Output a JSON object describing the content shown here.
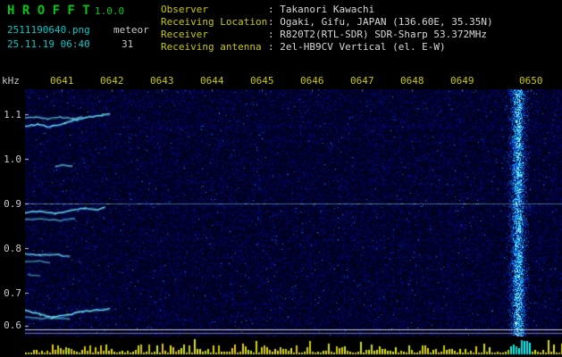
{
  "header": {
    "app_title": "H R O F F T",
    "version": "1.0.0",
    "filename": "2511190640.png",
    "station": "meteor",
    "datetime": "25.11.19 06:40",
    "echo_count": "31",
    "separator": ":",
    "info": [
      {
        "label": "Observer",
        "value": "Takanori Kawachi"
      },
      {
        "label": "Receiving Location",
        "value": "Ogaki, Gifu, JAPAN (136.60E, 35.35N)"
      },
      {
        "label": "Receiver",
        "value": "R820T2(RTL-SDR) SDR-Sharp 53.372MHz"
      },
      {
        "label": "Receiving antenna",
        "value": "2el-HB9CV Vertical (el. E-W)"
      }
    ]
  },
  "chart_data": {
    "type": "heatmap",
    "title": "HROFFT radio meteor spectrogram 0640-0650",
    "x_axis": {
      "tick_labels": [
        "0641",
        "0642",
        "0643",
        "0644",
        "0645",
        "0646",
        "0647",
        "0648",
        "0649",
        "0650"
      ],
      "minutes_per_division": 1
    },
    "y_axis": {
      "label": "kHz",
      "tick_labels": [
        "1.1",
        "1.0",
        "0.9",
        "0.8",
        "0.7",
        "0.6"
      ],
      "range_khz": [
        0.6,
        1.16
      ]
    },
    "carrier_line_khz": 0.9,
    "baseline_lines_khz": [
      0.618,
      0.61
    ],
    "echo_traces": [
      {
        "name": "drift-1a",
        "intensity": 0.95,
        "points": [
          [
            0,
            1.073
          ],
          [
            0.25,
            1.077
          ],
          [
            0.5,
            1.071
          ],
          [
            0.8,
            1.08
          ],
          [
            1.05,
            1.088
          ],
          [
            1.3,
            1.094
          ],
          [
            1.55,
            1.098
          ],
          [
            1.7,
            1.1
          ]
        ]
      },
      {
        "name": "drift-1b",
        "intensity": 0.65,
        "points": [
          [
            0,
            1.091
          ],
          [
            0.2,
            1.094
          ],
          [
            0.45,
            1.089
          ],
          [
            0.7,
            1.093
          ],
          [
            0.95,
            1.09
          ],
          [
            1.15,
            1.093
          ]
        ]
      },
      {
        "name": "dash-0.98",
        "intensity": 0.7,
        "points": [
          [
            0.6,
            0.984
          ],
          [
            0.75,
            0.986
          ],
          [
            0.95,
            0.983
          ]
        ]
      },
      {
        "name": "drift-2a",
        "intensity": 0.9,
        "points": [
          [
            0,
            0.879
          ],
          [
            0.3,
            0.883
          ],
          [
            0.6,
            0.877
          ],
          [
            0.9,
            0.884
          ],
          [
            1.2,
            0.889
          ],
          [
            1.45,
            0.886
          ],
          [
            1.6,
            0.891
          ]
        ]
      },
      {
        "name": "drift-2b",
        "intensity": 0.55,
        "points": [
          [
            0,
            0.864
          ],
          [
            0.35,
            0.866
          ],
          [
            0.7,
            0.862
          ],
          [
            1.0,
            0.866
          ]
        ]
      },
      {
        "name": "drift-3a",
        "intensity": 0.8,
        "points": [
          [
            0,
            0.787
          ],
          [
            0.3,
            0.784
          ],
          [
            0.6,
            0.786
          ],
          [
            0.9,
            0.781
          ]
        ]
      },
      {
        "name": "drift-3b",
        "intensity": 0.5,
        "points": [
          [
            0,
            0.769
          ],
          [
            0.25,
            0.771
          ],
          [
            0.5,
            0.768
          ]
        ]
      },
      {
        "name": "dash-0.74",
        "intensity": 0.45,
        "points": [
          [
            0.05,
            0.741
          ],
          [
            0.3,
            0.739
          ]
        ]
      },
      {
        "name": "drift-4a",
        "intensity": 0.95,
        "points": [
          [
            0,
            0.66
          ],
          [
            0.3,
            0.652
          ],
          [
            0.55,
            0.645
          ],
          [
            0.85,
            0.65
          ],
          [
            1.15,
            0.658
          ],
          [
            1.45,
            0.661
          ],
          [
            1.7,
            0.664
          ]
        ]
      },
      {
        "name": "drift-4b",
        "intensity": 0.55,
        "points": [
          [
            0,
            0.645
          ],
          [
            0.3,
            0.642
          ],
          [
            0.6,
            0.644
          ],
          [
            0.9,
            0.64
          ]
        ]
      }
    ],
    "strong_echo": {
      "center_min_after_0640": 9.85,
      "khz_range": [
        0.6,
        1.16
      ]
    },
    "colors": {
      "background": "#000000",
      "title_green": "#00c814",
      "cyan_text": "#00c8c8",
      "yellow_text": "#c8c800",
      "white_text": "#d8d8d8",
      "spectrogram_noise_blue": "#0000a0",
      "echo_trace_cyan": "#6ee1ff",
      "carrier_line": "#8cd2e6",
      "baseline_white": "#e1e1e1"
    }
  },
  "signal_meter": {
    "bar_color": "#d2d200",
    "echo_bar_color": "#00e0e0"
  }
}
